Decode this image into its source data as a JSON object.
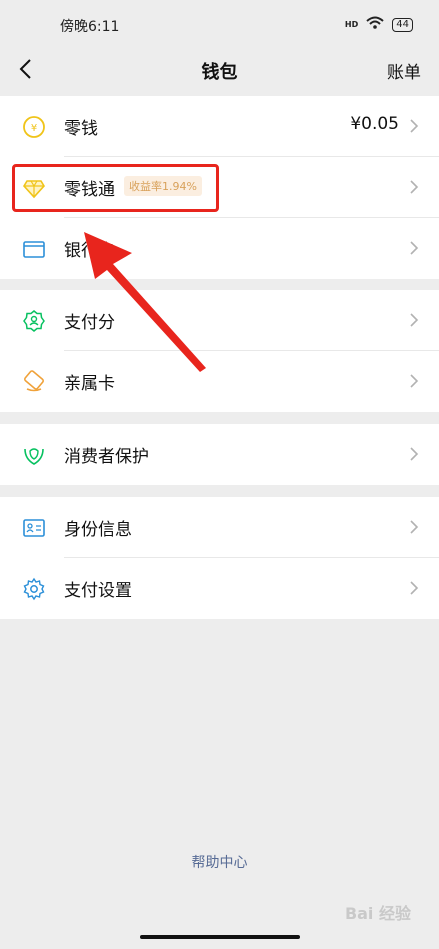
{
  "status_bar": {
    "time": "傍晚6:11",
    "signal": "HD",
    "battery": "44"
  },
  "nav": {
    "title": "钱包",
    "right_label": "账单"
  },
  "groups": [
    [
      {
        "label": "零钱",
        "value": "¥0.05",
        "icon": "yen-coin-icon"
      },
      {
        "label": "零钱通",
        "badge": "收益率1.94%",
        "icon": "diamond-icon"
      },
      {
        "label": "银行卡",
        "icon": "bank-card-icon"
      }
    ],
    [
      {
        "label": "支付分",
        "icon": "score-badge-icon"
      },
      {
        "label": "亲属卡",
        "icon": "family-card-icon"
      }
    ],
    [
      {
        "label": "消费者保护",
        "icon": "shield-hands-icon"
      }
    ],
    [
      {
        "label": "身份信息",
        "icon": "id-card-icon"
      },
      {
        "label": "支付设置",
        "icon": "gear-icon"
      }
    ]
  ],
  "footer": {
    "help": "帮助中心"
  },
  "watermark": "Bai 经验",
  "colors": {
    "brand_green": "#07c160",
    "highlight_red": "#e8251d",
    "link_blue": "#576b95"
  }
}
